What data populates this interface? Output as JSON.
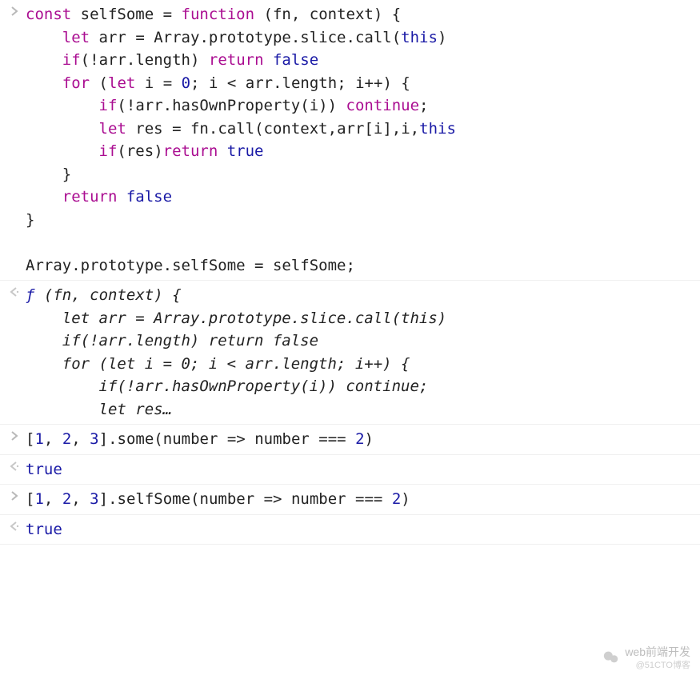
{
  "entries": [
    {
      "type": "input",
      "lines": [
        [
          [
            "kw",
            "const"
          ],
          [
            "sp",
            " "
          ],
          [
            "pl",
            "selfSome"
          ],
          [
            "sp",
            " "
          ],
          [
            "op",
            "="
          ],
          [
            "sp",
            " "
          ],
          [
            "kw",
            "function"
          ],
          [
            "sp",
            " "
          ],
          [
            "pl",
            "("
          ],
          [
            "pl",
            "fn"
          ],
          [
            "pl",
            ","
          ],
          [
            "sp",
            " "
          ],
          [
            "pl",
            "context"
          ],
          [
            "pl",
            ")"
          ],
          [
            "sp",
            " "
          ],
          [
            "pl",
            "{"
          ]
        ],
        [
          [
            "sp",
            "    "
          ],
          [
            "kw",
            "let"
          ],
          [
            "sp",
            " "
          ],
          [
            "pl",
            "arr"
          ],
          [
            "sp",
            " "
          ],
          [
            "op",
            "="
          ],
          [
            "sp",
            " "
          ],
          [
            "pl",
            "Array"
          ],
          [
            "pl",
            "."
          ],
          [
            "pl",
            "prototype"
          ],
          [
            "pl",
            "."
          ],
          [
            "pl",
            "slice"
          ],
          [
            "pl",
            "."
          ],
          [
            "pl",
            "call"
          ],
          [
            "pl",
            "("
          ],
          [
            "bl",
            "this"
          ],
          [
            "pl",
            ")"
          ]
        ],
        [
          [
            "sp",
            "    "
          ],
          [
            "kw",
            "if"
          ],
          [
            "pl",
            "("
          ],
          [
            "op",
            "!"
          ],
          [
            "pl",
            "arr"
          ],
          [
            "pl",
            "."
          ],
          [
            "pl",
            "length"
          ],
          [
            "pl",
            ")"
          ],
          [
            "sp",
            " "
          ],
          [
            "kw",
            "return"
          ],
          [
            "sp",
            " "
          ],
          [
            "bl",
            "false"
          ]
        ],
        [
          [
            "sp",
            "    "
          ],
          [
            "kw",
            "for"
          ],
          [
            "sp",
            " "
          ],
          [
            "pl",
            "("
          ],
          [
            "kw",
            "let"
          ],
          [
            "sp",
            " "
          ],
          [
            "pl",
            "i"
          ],
          [
            "sp",
            " "
          ],
          [
            "op",
            "="
          ],
          [
            "sp",
            " "
          ],
          [
            "bl",
            "0"
          ],
          [
            "pl",
            ";"
          ],
          [
            "sp",
            " "
          ],
          [
            "pl",
            "i"
          ],
          [
            "sp",
            " "
          ],
          [
            "op",
            "<"
          ],
          [
            "sp",
            " "
          ],
          [
            "pl",
            "arr"
          ],
          [
            "pl",
            "."
          ],
          [
            "pl",
            "length"
          ],
          [
            "pl",
            ";"
          ],
          [
            "sp",
            " "
          ],
          [
            "pl",
            "i"
          ],
          [
            "op",
            "++"
          ],
          [
            "pl",
            ")"
          ],
          [
            "sp",
            " "
          ],
          [
            "pl",
            "{"
          ]
        ],
        [
          [
            "sp",
            "        "
          ],
          [
            "kw",
            "if"
          ],
          [
            "pl",
            "("
          ],
          [
            "op",
            "!"
          ],
          [
            "pl",
            "arr"
          ],
          [
            "pl",
            "."
          ],
          [
            "pl",
            "hasOwnProperty"
          ],
          [
            "pl",
            "("
          ],
          [
            "pl",
            "i"
          ],
          [
            "pl",
            "))"
          ],
          [
            "sp",
            " "
          ],
          [
            "kw",
            "continue"
          ],
          [
            "pl",
            ";"
          ]
        ],
        [
          [
            "sp",
            "        "
          ],
          [
            "kw",
            "let"
          ],
          [
            "sp",
            " "
          ],
          [
            "pl",
            "res"
          ],
          [
            "sp",
            " "
          ],
          [
            "op",
            "="
          ],
          [
            "sp",
            " "
          ],
          [
            "pl",
            "fn"
          ],
          [
            "pl",
            "."
          ],
          [
            "pl",
            "call"
          ],
          [
            "pl",
            "("
          ],
          [
            "pl",
            "context"
          ],
          [
            "pl",
            ","
          ],
          [
            "pl",
            "arr"
          ],
          [
            "pl",
            "["
          ],
          [
            "pl",
            "i"
          ],
          [
            "pl",
            "]"
          ],
          [
            "pl",
            ","
          ],
          [
            "pl",
            "i"
          ],
          [
            "pl",
            ","
          ],
          [
            "bl",
            "this"
          ]
        ],
        [
          [
            "sp",
            "        "
          ],
          [
            "kw",
            "if"
          ],
          [
            "pl",
            "("
          ],
          [
            "pl",
            "res"
          ],
          [
            "pl",
            ")"
          ],
          [
            "kw",
            "return"
          ],
          [
            "sp",
            " "
          ],
          [
            "bl",
            "true"
          ]
        ],
        [
          [
            "sp",
            "    "
          ],
          [
            "pl",
            "}"
          ]
        ],
        [
          [
            "sp",
            "    "
          ],
          [
            "kw",
            "return"
          ],
          [
            "sp",
            " "
          ],
          [
            "bl",
            "false"
          ]
        ],
        [
          [
            "pl",
            "}"
          ]
        ],
        [
          [
            "sp",
            ""
          ]
        ],
        [
          [
            "pl",
            "Array"
          ],
          [
            "pl",
            "."
          ],
          [
            "pl",
            "prototype"
          ],
          [
            "pl",
            "."
          ],
          [
            "pl",
            "selfSome"
          ],
          [
            "sp",
            " "
          ],
          [
            "op",
            "="
          ],
          [
            "sp",
            " "
          ],
          [
            "pl",
            "selfSome"
          ],
          [
            "pl",
            ";"
          ]
        ]
      ]
    },
    {
      "type": "output",
      "italic": true,
      "lines": [
        [
          [
            "blit",
            "ƒ"
          ],
          [
            "sp",
            " "
          ],
          [
            "it",
            "("
          ],
          [
            "it",
            "fn"
          ],
          [
            "it",
            ","
          ],
          [
            "sp",
            " "
          ],
          [
            "it",
            "context"
          ],
          [
            "it",
            ")"
          ],
          [
            "sp",
            " "
          ],
          [
            "it",
            "{"
          ]
        ],
        [
          [
            "sp",
            "    "
          ],
          [
            "it",
            "let arr = Array.prototype.slice.call(this)"
          ]
        ],
        [
          [
            "sp",
            "    "
          ],
          [
            "it",
            "if(!arr.length) return false"
          ]
        ],
        [
          [
            "sp",
            "    "
          ],
          [
            "it",
            "for (let i = 0; i < arr.length; i++) {"
          ]
        ],
        [
          [
            "sp",
            "        "
          ],
          [
            "it",
            "if(!arr.hasOwnProperty(i)) continue;"
          ]
        ],
        [
          [
            "sp",
            "        "
          ],
          [
            "it",
            "let res…"
          ]
        ]
      ]
    },
    {
      "type": "input",
      "lines": [
        [
          [
            "pl",
            "["
          ],
          [
            "bl",
            "1"
          ],
          [
            "pl",
            ","
          ],
          [
            "sp",
            " "
          ],
          [
            "bl",
            "2"
          ],
          [
            "pl",
            ","
          ],
          [
            "sp",
            " "
          ],
          [
            "bl",
            "3"
          ],
          [
            "pl",
            "]"
          ],
          [
            "pl",
            "."
          ],
          [
            "pl",
            "some"
          ],
          [
            "pl",
            "("
          ],
          [
            "pl",
            "number"
          ],
          [
            "sp",
            " "
          ],
          [
            "op",
            "=>"
          ],
          [
            "sp",
            " "
          ],
          [
            "pl",
            "number"
          ],
          [
            "sp",
            " "
          ],
          [
            "op",
            "==="
          ],
          [
            "sp",
            " "
          ],
          [
            "bl",
            "2"
          ],
          [
            "pl",
            ")"
          ]
        ]
      ]
    },
    {
      "type": "output",
      "lines": [
        [
          [
            "bl",
            "true"
          ]
        ]
      ]
    },
    {
      "type": "input",
      "lines": [
        [
          [
            "pl",
            "["
          ],
          [
            "bl",
            "1"
          ],
          [
            "pl",
            ","
          ],
          [
            "sp",
            " "
          ],
          [
            "bl",
            "2"
          ],
          [
            "pl",
            ","
          ],
          [
            "sp",
            " "
          ],
          [
            "bl",
            "3"
          ],
          [
            "pl",
            "]"
          ],
          [
            "pl",
            "."
          ],
          [
            "pl",
            "selfSome"
          ],
          [
            "pl",
            "("
          ],
          [
            "pl",
            "number"
          ],
          [
            "sp",
            " "
          ],
          [
            "op",
            "=>"
          ],
          [
            "sp",
            " "
          ],
          [
            "pl",
            "number"
          ],
          [
            "sp",
            " "
          ],
          [
            "op",
            "==="
          ],
          [
            "sp",
            " "
          ],
          [
            "bl",
            "2"
          ],
          [
            "pl",
            ")"
          ]
        ]
      ]
    },
    {
      "type": "output",
      "lines": [
        [
          [
            "bl",
            "true"
          ]
        ]
      ]
    }
  ],
  "watermark": {
    "main": "web前端开发",
    "sub": "@51CTO博客"
  }
}
